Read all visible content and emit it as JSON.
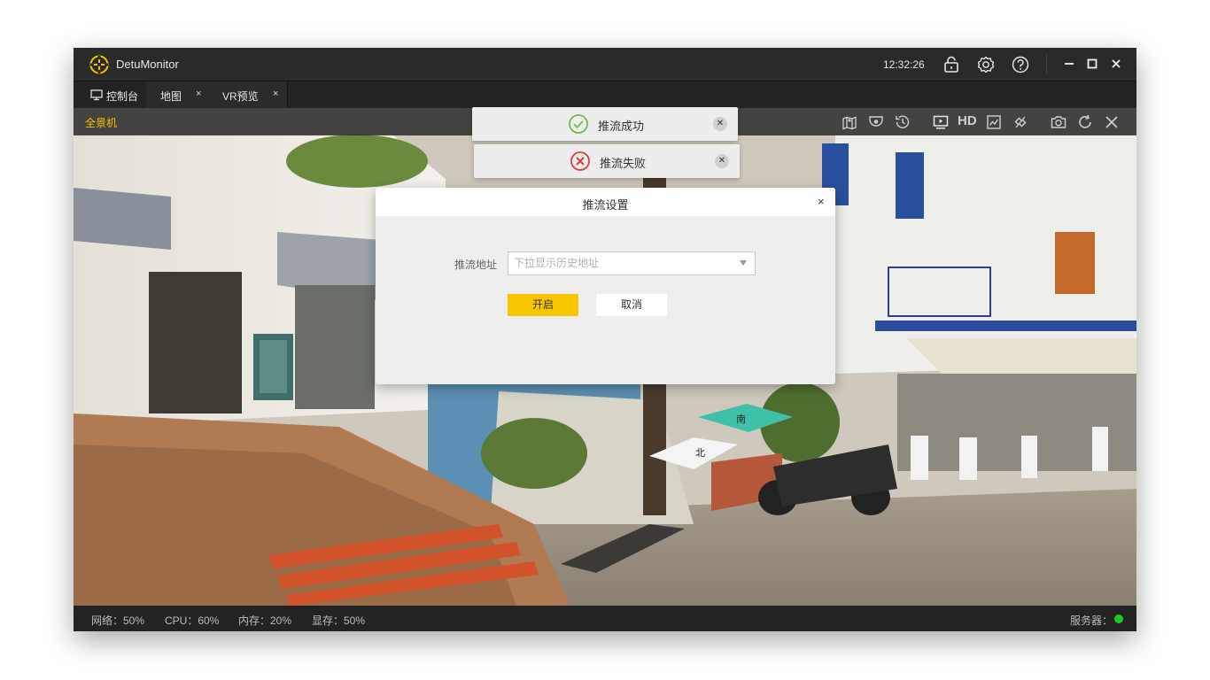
{
  "titlebar": {
    "app_title": "DetuMonitor",
    "clock": "12:32:26",
    "icons": [
      "lock-icon",
      "settings-icon",
      "help-icon",
      "minimize-icon",
      "maximize-icon",
      "close-icon"
    ]
  },
  "tabs": [
    {
      "label": "控制台",
      "icon": "monitor-icon",
      "closable": false
    },
    {
      "label": "地图",
      "closable": true,
      "close": "×"
    },
    {
      "label": "VR预览",
      "closable": true,
      "close": "×"
    }
  ],
  "viewer": {
    "camera_label": "全景机",
    "toolbar_icons": [
      "map-pin-icon",
      "camera-dome-icon",
      "history-icon",
      "screen-icon",
      "hd-icon",
      "chart-icon",
      "link-icon",
      "snapshot-icon",
      "refresh-icon",
      "close-icon"
    ],
    "hd_label": "HD",
    "compass": {
      "south": "南",
      "north": "北"
    }
  },
  "toasts": [
    {
      "message": "推流成功",
      "status": "success",
      "color": "#6cc04a"
    },
    {
      "message": "推流失败",
      "status": "error",
      "color": "#e23b3b"
    }
  ],
  "dialog": {
    "title": "推流设置",
    "close": "×",
    "field_label": "推流地址",
    "field_placeholder": "下拉显示历史地址",
    "start_label": "开启",
    "cancel_label": "取消"
  },
  "statusbar": {
    "network": "网络：50%",
    "cpu": "CPU：60%",
    "memory": "内存：20%",
    "gpu_memory": "显存：50%",
    "server": "服务器：",
    "server_status_color": "#1ec81e"
  },
  "colors": {
    "accent": "#f7c600",
    "titlebar_bg": "#2a2a2a",
    "camera_label": "#f2c200"
  }
}
